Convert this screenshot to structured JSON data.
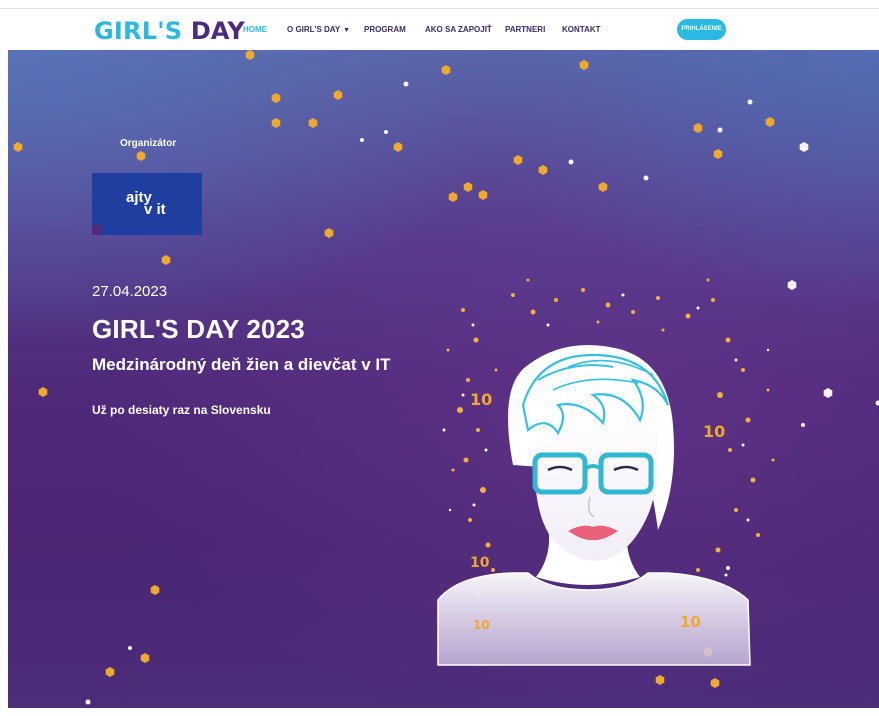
{
  "header": {
    "logo": {
      "part1": "GIRL'S",
      "part2": "DAY"
    },
    "nav": [
      {
        "label": "HOME",
        "active": true
      },
      {
        "label": "O GIRL'S DAY",
        "has_dropdown": true
      },
      {
        "label": "PROGRAM"
      },
      {
        "label": "AKO SA ZAPOJIŤ"
      },
      {
        "label": "PARTNERI"
      },
      {
        "label": "KONTAKT"
      }
    ],
    "login_label": "PRIHLÁSENIE"
  },
  "hero": {
    "organizer_label": "Organizátor",
    "organizer_logo": {
      "line1": "ajty",
      "line2": "v it"
    },
    "date": "27.04.2023",
    "title": "GIRL'S DAY 2023",
    "subtitle": "Medzinárodný deň žien a dievčat v IT",
    "tagline": "Už po desiaty raz na Slovensku",
    "portrait_badge": "10"
  },
  "colors": {
    "accent_blue": "#29b9e2",
    "brand_purple": "#4d2a7c",
    "gold": "#f0a92b",
    "hero_purple": "#4f2a7a"
  },
  "icons": {
    "dropdown": "chevron-down-icon"
  }
}
